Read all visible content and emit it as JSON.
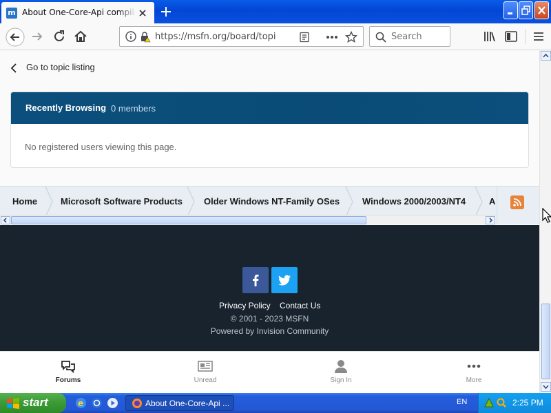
{
  "browser": {
    "tab_title": "About One-Core-Api compilation - MSFN",
    "tab_favicon_letter": "m",
    "url": "https://msfn.org/board/topic/",
    "search_placeholder": "Search"
  },
  "page": {
    "back_link": "Go to topic listing",
    "recently_browsing": {
      "title": "Recently Browsing",
      "count": "0 members",
      "body": "No registered users viewing this page."
    },
    "breadcrumb": [
      "Home",
      "Microsoft Software Products",
      "Older Windows NT-Family OSes",
      "Windows 2000/2003/NT4",
      "Al"
    ],
    "footer": {
      "privacy": "Privacy Policy",
      "contact": "Contact Us",
      "copyright": "© 2001 - 2023 MSFN",
      "powered": "Powered by Invision Community"
    },
    "mobile_nav": [
      {
        "label": "Forums",
        "icon": "chat-bubbles-icon",
        "active": true
      },
      {
        "label": "Unread",
        "icon": "newspaper-icon",
        "active": false
      },
      {
        "label": "Sign In",
        "icon": "user-icon",
        "active": false
      },
      {
        "label": "More",
        "icon": "more-dots-icon",
        "active": false
      }
    ]
  },
  "taskbar": {
    "start": "start",
    "window_button": "About One-Core-Api ...",
    "language": "EN",
    "clock": "2:25 PM"
  },
  "colors": {
    "header_blue": "#0b4f7a",
    "footer_dark": "#18232e",
    "facebook": "#3b5998",
    "twitter": "#1da1f2",
    "rss": "#e8833a"
  }
}
